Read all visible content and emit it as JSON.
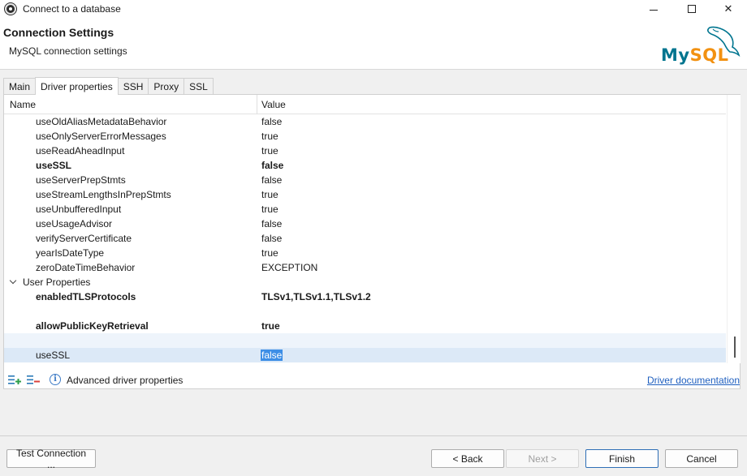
{
  "window": {
    "title": "Connect to a database",
    "minimize_icon": "minimize-icon",
    "maximize_icon": "maximize-icon",
    "close_glyph": "✕"
  },
  "header": {
    "title": "Connection Settings",
    "subtitle": "MySQL connection settings",
    "logo_text_my": "My",
    "logo_text_sql": "SQL",
    "logo_colors": {
      "my": "#00758f",
      "sql": "#f29111"
    }
  },
  "tabs": [
    {
      "label": "Main",
      "active": false
    },
    {
      "label": "Driver properties",
      "active": true
    },
    {
      "label": "SSH",
      "active": false
    },
    {
      "label": "Proxy",
      "active": false
    },
    {
      "label": "SSL",
      "active": false
    }
  ],
  "table": {
    "columns": {
      "name": "Name",
      "value": "Value"
    },
    "rows": [
      {
        "name": "useOldAliasMetadataBehavior",
        "value": "false"
      },
      {
        "name": "useOnlyServerErrorMessages",
        "value": "true"
      },
      {
        "name": "useReadAheadInput",
        "value": "true"
      },
      {
        "name": "useSSL",
        "value": "false",
        "bold": true
      },
      {
        "name": "useServerPrepStmts",
        "value": "false"
      },
      {
        "name": "useStreamLengthsInPrepStmts",
        "value": "true"
      },
      {
        "name": "useUnbufferedInput",
        "value": "true"
      },
      {
        "name": "useUsageAdvisor",
        "value": "false"
      },
      {
        "name": "verifyServerCertificate",
        "value": "false"
      },
      {
        "name": "yearIsDateType",
        "value": "true"
      },
      {
        "name": "zeroDateTimeBehavior",
        "value": "EXCEPTION"
      }
    ],
    "group": {
      "label": "User Properties",
      "expanded": true
    },
    "user_rows": [
      {
        "name": "enabledTLSProtocols",
        "value": "TLSv1,TLSv1.1,TLSv1.2"
      },
      {
        "name": "allowPublicKeyRetrieval",
        "value": "true"
      },
      {
        "name": "useSSL",
        "value": "false"
      }
    ]
  },
  "footer": {
    "advanced_label": "Advanced driver properties",
    "doc_link": "Driver documentation"
  },
  "buttons": {
    "test": "Test Connection ...",
    "back": "< Back",
    "next": "Next >",
    "finish": "Finish",
    "cancel": "Cancel"
  }
}
